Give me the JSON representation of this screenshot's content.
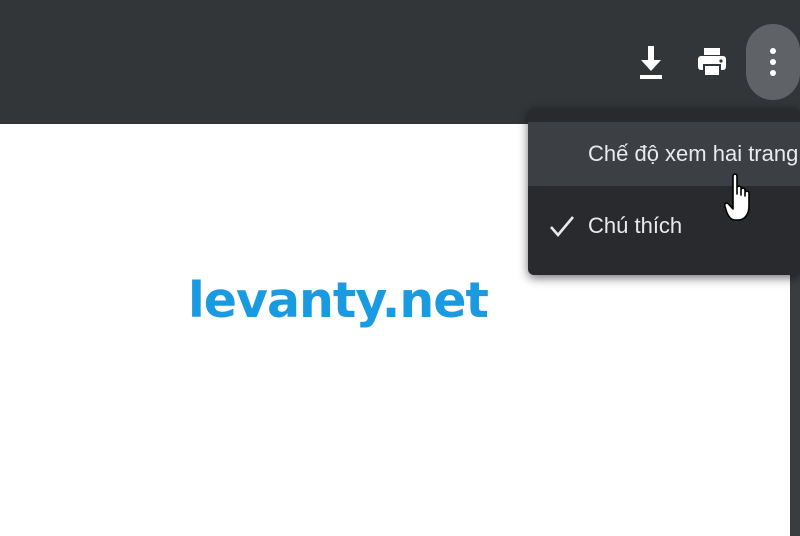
{
  "toolbar": {
    "icons": [
      "download-icon",
      "print-icon",
      "more-vert-icon"
    ]
  },
  "menu": {
    "items": [
      {
        "label": "Chế độ xem hai trang",
        "checked": false
      },
      {
        "label": "Chú thích",
        "checked": true
      }
    ]
  },
  "page": {
    "watermark": "levanty.net"
  },
  "colors": {
    "toolbar": "#323639",
    "menu_bg": "#292a2d",
    "menu_hover": "#3c3f43",
    "watermark": "#1a9ae0"
  }
}
